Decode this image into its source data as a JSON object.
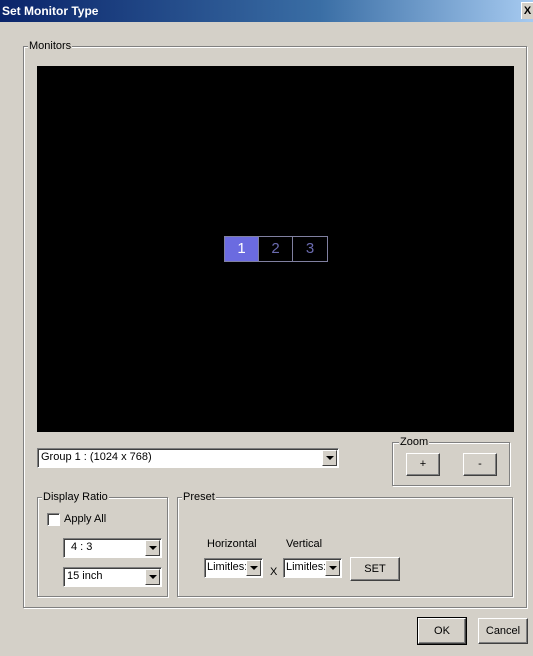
{
  "window": {
    "title": "Set Monitor Type",
    "close_label": "X"
  },
  "monitors": {
    "legend": "Monitors",
    "cells": [
      {
        "label": "1",
        "selected": true
      },
      {
        "label": "2",
        "selected": false
      },
      {
        "label": "3",
        "selected": false
      }
    ],
    "group_select": "Group 1 : (1024 x 768)"
  },
  "zoom": {
    "legend": "Zoom",
    "plus": "+",
    "minus": "-"
  },
  "display_ratio": {
    "legend": "Display Ratio",
    "apply_all_label": "Apply All",
    "apply_all_checked": false,
    "ratio_value": "4 : 3",
    "size_value": "15 inch"
  },
  "preset": {
    "legend": "Preset",
    "horizontal_label": "Horizontal",
    "vertical_label": "Vertical",
    "horizontal_value": "Limitles:",
    "vertical_value": "Limitles:",
    "x_label": "X",
    "set_label": "SET"
  },
  "footer": {
    "ok_label": "OK",
    "cancel_label": "Cancel"
  }
}
